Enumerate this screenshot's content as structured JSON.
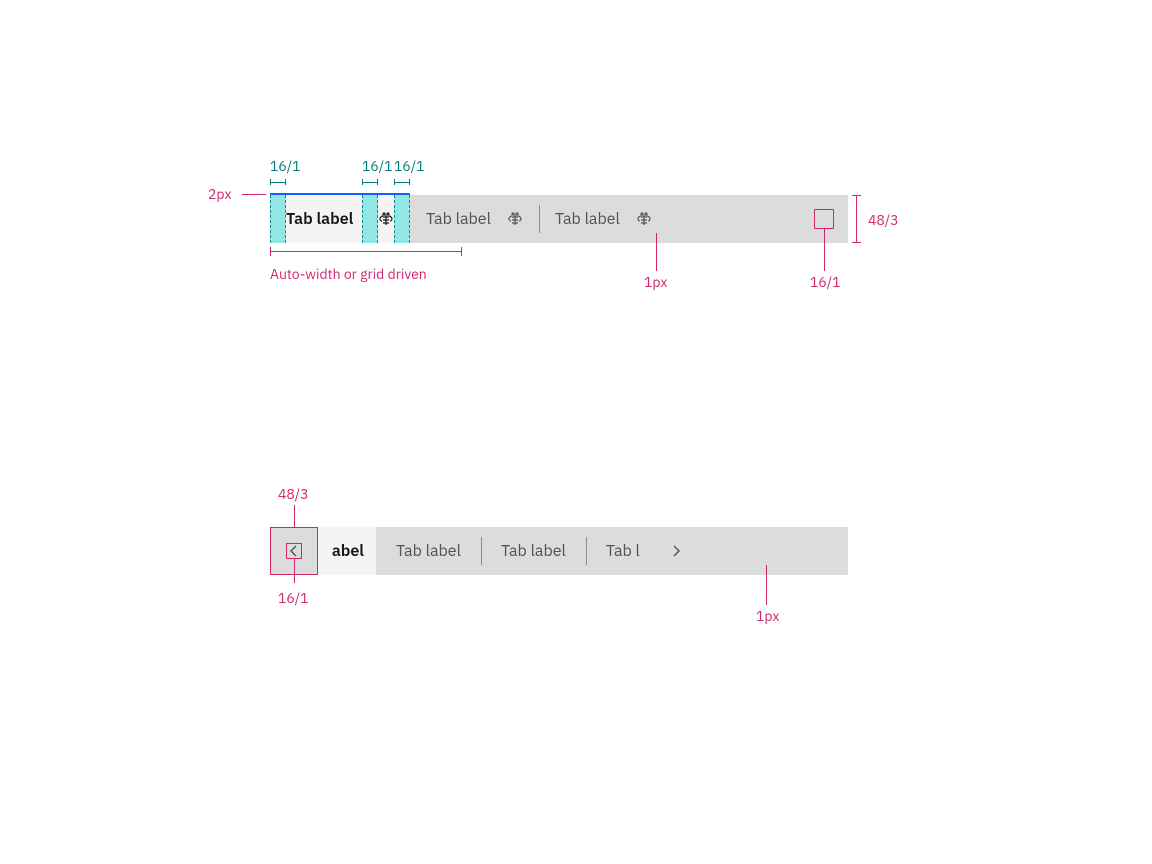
{
  "colors": {
    "accent_blue": "#0f62fe",
    "annotation_pink": "#d12771",
    "annotation_teal": "#007d79",
    "teal_fill": "#87e6e2",
    "tab_bg": "#dcdcdc",
    "tab_active_bg": "#f4f4f4"
  },
  "figure1": {
    "tabs": [
      {
        "label": "Tab label",
        "icon": "bee-icon",
        "active": true
      },
      {
        "label": "Tab label",
        "icon": "bee-icon",
        "active": false
      },
      {
        "label": "Tab label",
        "icon": "bee-icon",
        "active": false
      }
    ],
    "annotations": {
      "padding_markers": [
        "16/1",
        "16/1",
        "16/1"
      ],
      "top_indicator": "2px",
      "height": "48/3",
      "width_note": "Auto-width or grid driven",
      "divider": "1px",
      "icon_size": "16/1"
    }
  },
  "figure2": {
    "nav_prev_icon": "chevron-left-icon",
    "nav_next_icon": "chevron-right-icon",
    "tabs": [
      {
        "label": "abel",
        "active": true
      },
      {
        "label": "Tab label",
        "active": false
      },
      {
        "label": "Tab label",
        "active": false
      },
      {
        "label": "Tab l",
        "active": false,
        "clipped": true
      }
    ],
    "annotations": {
      "nav_button_size": "48/3",
      "icon_size": "16/1",
      "divider": "1px"
    }
  }
}
